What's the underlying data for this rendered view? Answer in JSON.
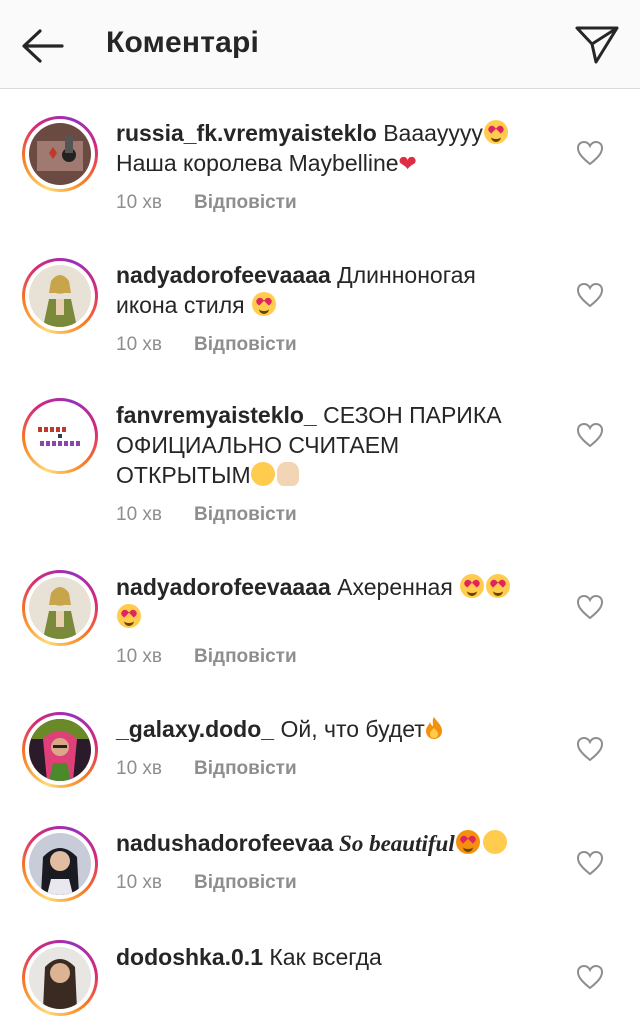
{
  "header": {
    "title": "Коментарі"
  },
  "comments": [
    {
      "username": "russia_fk.vremyaisteklo",
      "text1": " Вааayyyy",
      "text2": "Наша королева Maybelline",
      "time": "10 хв",
      "reply": "Відповісти"
    },
    {
      "username": "nadyadorofeevaaaa",
      "text1": " Длинноногая",
      "text2": "икона стиля ",
      "time": "10 хв",
      "reply": "Відповісти"
    },
    {
      "username": "fanvremyaisteklo_",
      "text1": " СЕЗОН ПАРИКА",
      "text2": "ОФИЦИАЛЬНО СЧИТАЕМ",
      "text3": "ОТКРЫТЫМ",
      "time": "10 хв",
      "reply": "Відповісти"
    },
    {
      "username": "nadyadorofeevaaaa",
      "text1": " Ахеренная ",
      "time": "10 хв",
      "reply": "Відповісти"
    },
    {
      "username": "_galaxy.dodo_",
      "text1": " Ой, что будет",
      "time": "10 хв",
      "reply": "Відповісти"
    },
    {
      "username": "nadushadorofeevaa",
      "text1": " So beautiful",
      "time": "10 хв",
      "reply": "Відповісти"
    },
    {
      "username": "dodoshka.0.1",
      "text1": " Как всегда"
    }
  ],
  "avatar_badge_text": "Время и Стекло",
  "colors": {
    "text": "#262626",
    "meta": "#8e8e8e",
    "ring_start": "#feda75",
    "ring_end": "#962fbf"
  },
  "icons": {
    "back": "arrow-left-icon",
    "send": "paper-plane-icon",
    "like": "heart-outline-icon"
  }
}
